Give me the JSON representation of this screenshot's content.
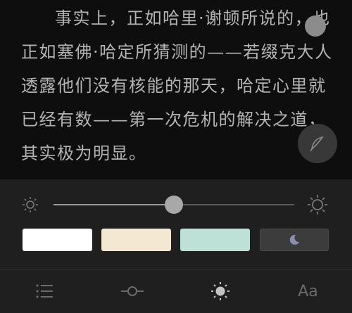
{
  "reader": {
    "paragraph_1": "事实上，正如哈里·谢顿所说的，也正如塞佛·哈定所猜测的——若缀克大人透露他们没有核能的那天，哈定心里就已经有数——第一次危机的解决之道，其实极为明显。",
    "partial_line": "危机的解决之道"
  },
  "settings": {
    "brightness": 0.5,
    "themes": [
      {
        "name": "white",
        "color": "#ffffff"
      },
      {
        "name": "sepia",
        "color": "#f5e8d2"
      },
      {
        "name": "green",
        "color": "#bfe0d6"
      },
      {
        "name": "night",
        "color": "#3c3c3c"
      }
    ]
  },
  "toolbar": {
    "font_label": "Aa",
    "tabs": [
      "table-of-contents",
      "progress",
      "brightness",
      "font"
    ]
  }
}
